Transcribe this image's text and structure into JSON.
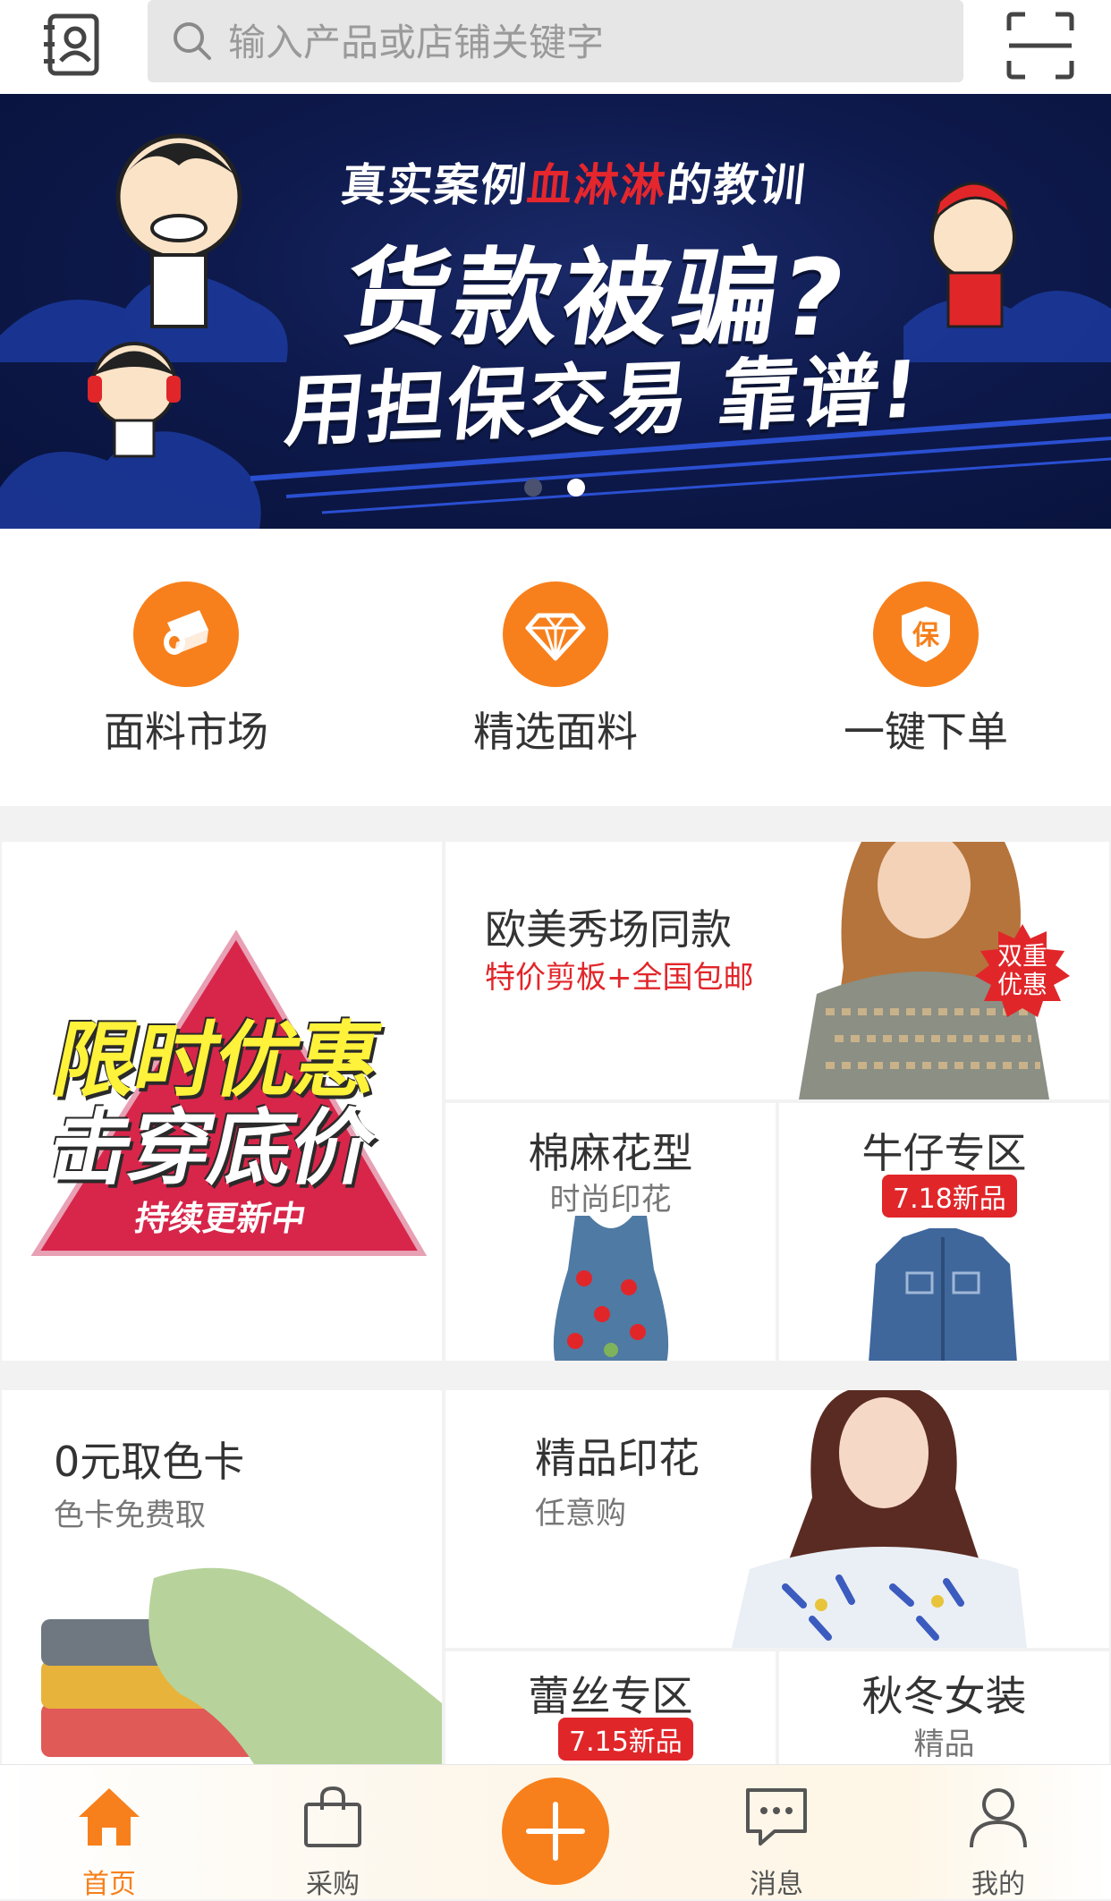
{
  "search": {
    "placeholder": "输入产品或店铺关键字"
  },
  "banner": {
    "line1_prefix": "真实案例",
    "line1_red": "血淋淋",
    "line1_suffix": "的教训",
    "line2": "货款被骗?",
    "line3": "用担保交易 靠谱!",
    "dot_colors": [
      "#4a5270",
      "#ffffff"
    ]
  },
  "quick": [
    {
      "label": "面料市场",
      "icon": "fabric-roll-icon"
    },
    {
      "label": "精选面料",
      "icon": "diamond-icon"
    },
    {
      "label": "一键下单",
      "icon": "shield-bao-icon",
      "glyph": "保"
    }
  ],
  "promo1": {
    "big": {
      "line1": "限时优惠",
      "line2": "击穿底价",
      "ribbon": "持续更新中"
    },
    "top_right": {
      "title": "欧美秀场同款",
      "subtitle": "特价剪板+全国包邮",
      "starburst": "双重优惠"
    },
    "cell_a": {
      "title": "棉麻花型",
      "subtitle": "时尚印花"
    },
    "cell_b": {
      "title": "牛仔专区",
      "badge": "7.18新品"
    }
  },
  "promo2": {
    "left": {
      "title": "0元取色卡",
      "subtitle": "色卡免费取"
    },
    "top_right": {
      "title": "精品印花",
      "subtitle": "任意购"
    },
    "cell_a": {
      "title": "蕾丝专区",
      "badge": "7.15新品"
    },
    "cell_b": {
      "title": "秋冬女装",
      "subtitle": "精品"
    }
  },
  "tabbar": {
    "items": [
      {
        "label": "首页",
        "icon": "home-icon",
        "active": true
      },
      {
        "label": "采购",
        "icon": "shopping-bag-icon",
        "active": false
      },
      {
        "label": "消息",
        "icon": "chat-bubble-icon",
        "active": false
      },
      {
        "label": "我的",
        "icon": "user-icon",
        "active": false
      }
    ],
    "center_icon": "plus-icon"
  },
  "colors": {
    "accent": "#f7801c",
    "sale_red": "#e1262a",
    "banner_bg": "#0e1a4d"
  }
}
